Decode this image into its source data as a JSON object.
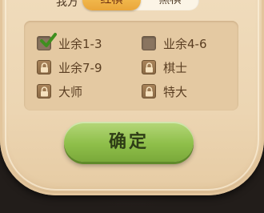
{
  "header": {
    "side_label": "我方",
    "side_options": [
      "红棋",
      "黑棋"
    ],
    "selected_side": "红棋"
  },
  "levels": [
    {
      "label": "业余1-3",
      "state": "checked",
      "icon": "checkmark-icon"
    },
    {
      "label": "业余4-6",
      "state": "unchecked",
      "icon": ""
    },
    {
      "label": "业余7-9",
      "state": "locked",
      "icon": "lock-icon"
    },
    {
      "label": "棋士",
      "state": "locked",
      "icon": "lock-icon"
    },
    {
      "label": "大师",
      "state": "locked",
      "icon": "lock-icon"
    },
    {
      "label": "特大",
      "state": "locked",
      "icon": "lock-icon"
    }
  ],
  "confirm_label": "确定",
  "colors": {
    "dialog_bg": "#ecd5b2",
    "selected_segment": "#eaa63a",
    "confirm_button": "#8fbf4a",
    "check_green": "#3f8f1f"
  }
}
